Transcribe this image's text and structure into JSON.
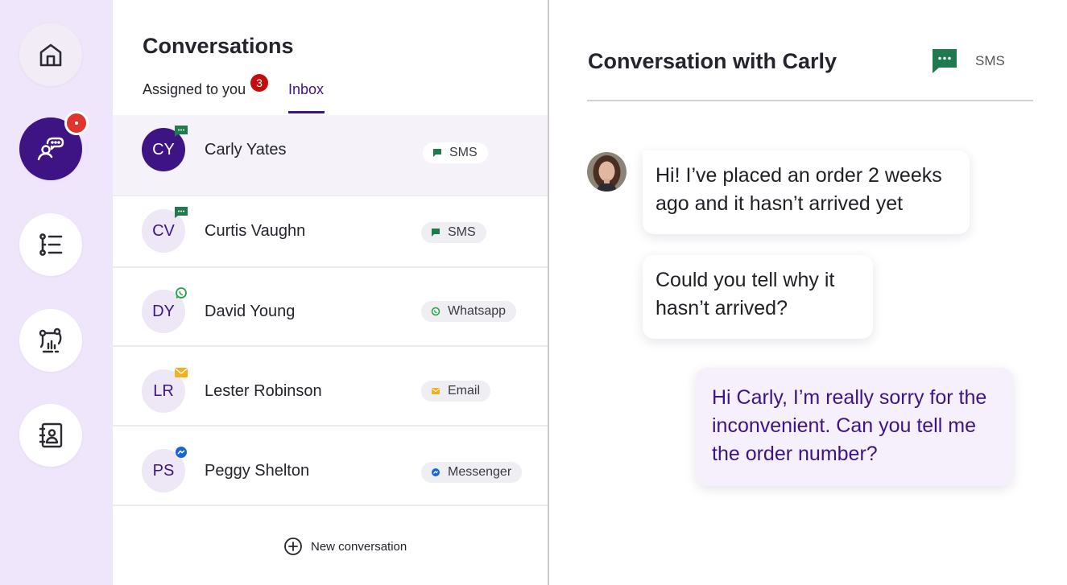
{
  "sidebar": {
    "items": [
      {
        "icon": "home-icon"
      },
      {
        "icon": "conversations-icon",
        "active": true,
        "notification": true
      },
      {
        "icon": "flow-list-icon"
      },
      {
        "icon": "analytics-icon"
      },
      {
        "icon": "contacts-book-icon"
      }
    ]
  },
  "list": {
    "title": "Conversations",
    "tabs": {
      "assigned": "Assigned to you",
      "assigned_count": "3",
      "inbox": "Inbox"
    },
    "contacts": [
      {
        "initials": "CY",
        "name": "Carly Yates",
        "channel": "SMS",
        "channel_icon": "sms-icon",
        "selected": true
      },
      {
        "initials": "CV",
        "name": "Curtis Vaughn",
        "channel": "SMS",
        "channel_icon": "sms-icon"
      },
      {
        "initials": "DY",
        "name": "David Young",
        "channel": "Whatsapp",
        "channel_icon": "whatsapp-icon"
      },
      {
        "initials": "LR",
        "name": "Lester Robinson",
        "channel": "Email",
        "channel_icon": "email-icon"
      },
      {
        "initials": "PS",
        "name": "Peggy Shelton",
        "channel": "Messenger",
        "channel_icon": "messenger-icon"
      }
    ],
    "new_conversation": "New conversation"
  },
  "conversation": {
    "title": "Conversation with Carly",
    "channel": "SMS",
    "messages": [
      {
        "from": "customer",
        "text": "Hi! I’ve placed an order 2 weeks ago and it hasn’t arrived yet"
      },
      {
        "from": "customer",
        "text": "Could you tell why it hasn’t arrived?"
      },
      {
        "from": "agent",
        "text": "Hi Carly, I’m really sorry for the inconvenient. Can you tell me the order number?"
      }
    ]
  },
  "colors": {
    "primary": "#3e1484",
    "sidebar_bg": "#efe6fb",
    "notification": "#e0342f",
    "sms_green": "#1f7a4d",
    "whatsapp_green": "#25a244",
    "email_yellow": "#f2b01e",
    "messenger_blue": "#1765d6"
  }
}
